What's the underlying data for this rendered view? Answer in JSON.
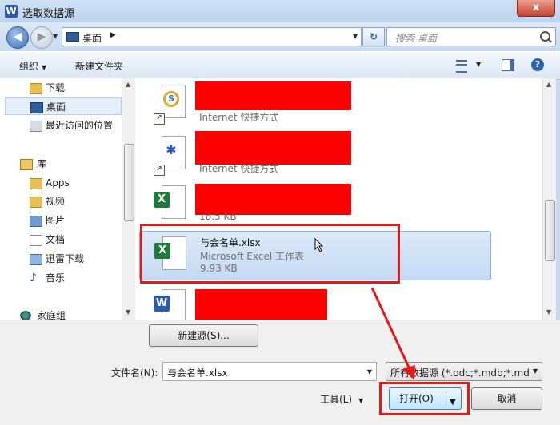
{
  "window": {
    "title": "选取数据源",
    "app_icon_letter": "W",
    "close_symbol": "x"
  },
  "navbar": {
    "back_symbol": "◀",
    "forward_symbol": "▶",
    "address": "桌面",
    "address_separator": "▶",
    "search_placeholder": "搜索 桌面"
  },
  "toolbar": {
    "organize_label": "组织",
    "new_folder_label": "新建文件夹",
    "help_symbol": "?"
  },
  "nav_pane": {
    "items": [
      {
        "label": "下载",
        "icon": "folder-icon"
      },
      {
        "label": "桌面",
        "icon": "desktop-icon",
        "selected": true
      },
      {
        "label": "最近访问的位置",
        "icon": "recent-places-icon"
      },
      {
        "label": "库",
        "icon": "library-icon"
      },
      {
        "label": "Apps",
        "icon": "folder-icon"
      },
      {
        "label": "视频",
        "icon": "videos-icon"
      },
      {
        "label": "图片",
        "icon": "pictures-icon"
      },
      {
        "label": "文档",
        "icon": "documents-icon"
      },
      {
        "label": "迅雷下载",
        "icon": "download-folder-icon"
      },
      {
        "label": "音乐",
        "icon": "music-icon"
      },
      {
        "label": "家庭组",
        "icon": "homegroup-icon"
      }
    ]
  },
  "files": {
    "items": [
      {
        "name": "",
        "type": "Internet 快捷方式",
        "size": "",
        "icon": "browser-shortcut-icon",
        "redacted": true
      },
      {
        "name": "",
        "type": "Internet 快捷方式",
        "size": "",
        "icon": "baidu-shortcut-icon",
        "redacted": true
      },
      {
        "name": "",
        "type": "",
        "size": "18.5 KB",
        "icon": "excel-file-icon",
        "redacted": true
      },
      {
        "name": "与会名单.xlsx",
        "type": "Microsoft Excel 工作表",
        "size": "9.93 KB",
        "icon": "excel-file-icon",
        "selected": true
      },
      {
        "name": "",
        "type": "",
        "size": "",
        "icon": "word-file-icon",
        "redacted": true
      }
    ]
  },
  "bottom": {
    "new_source_label": "新建源(S)...",
    "filename_label": "文件名(N):",
    "filename_value": "与会名单.xlsx",
    "filter_value": "所有数据源 (*.odc;*.mdb;*.mde",
    "tools_label": "工具(L)",
    "open_label": "打开(O)",
    "cancel_label": "取消"
  },
  "colors": {
    "highlight_red": "#e21a1a",
    "redaction_red": "#ff0000",
    "selection_blue": "#c4daf3"
  }
}
